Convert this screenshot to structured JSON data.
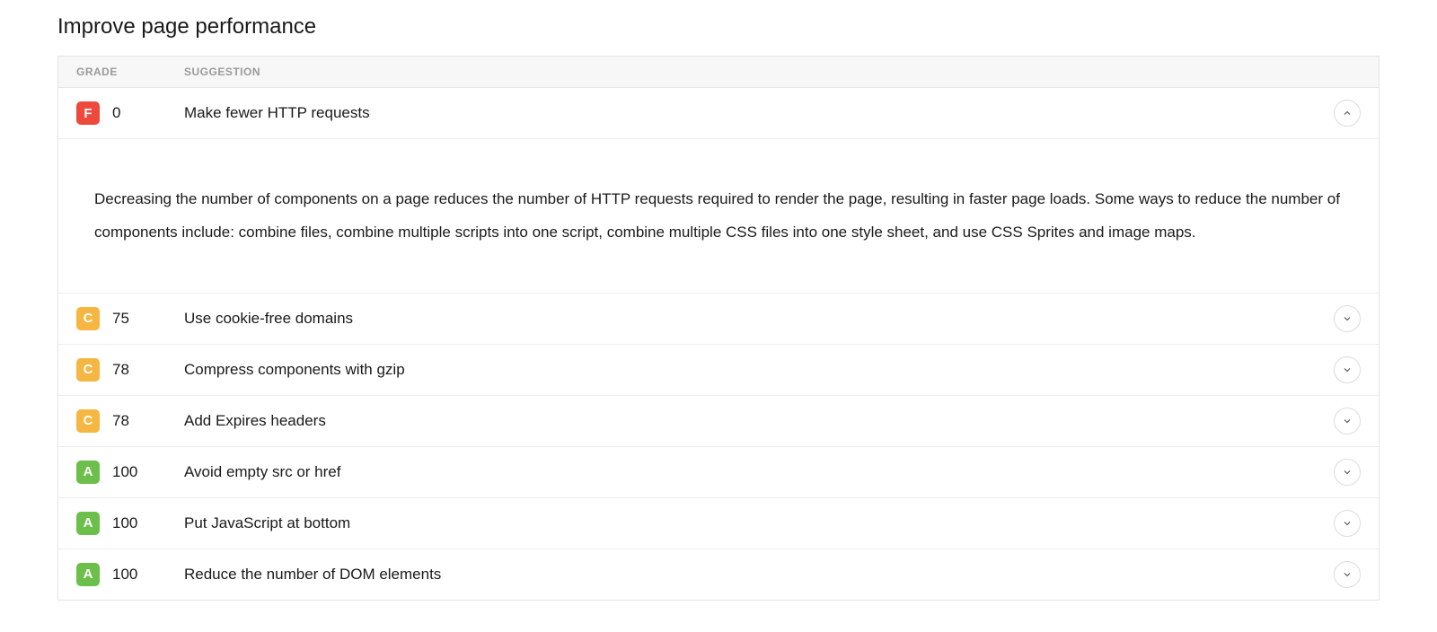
{
  "title": "Improve page performance",
  "columns": {
    "grade": "GRADE",
    "suggestion": "SUGGESTION"
  },
  "gradeColors": {
    "F": "#ed4a3d",
    "C": "#f5b642",
    "A": "#6bbf4a"
  },
  "rows": [
    {
      "grade": "F",
      "score": "0",
      "suggestion": "Make fewer HTTP requests",
      "expanded": true,
      "details": "Decreasing the number of components on a page reduces the number of HTTP requests required to render the page, resulting in faster page loads. Some ways to reduce the number of components include: combine files, combine multiple scripts into one script, combine multiple CSS files into one style sheet, and use CSS Sprites and image maps."
    },
    {
      "grade": "C",
      "score": "75",
      "suggestion": "Use cookie-free domains",
      "expanded": false
    },
    {
      "grade": "C",
      "score": "78",
      "suggestion": "Compress components with gzip",
      "expanded": false
    },
    {
      "grade": "C",
      "score": "78",
      "suggestion": "Add Expires headers",
      "expanded": false
    },
    {
      "grade": "A",
      "score": "100",
      "suggestion": "Avoid empty src or href",
      "expanded": false
    },
    {
      "grade": "A",
      "score": "100",
      "suggestion": "Put JavaScript at bottom",
      "expanded": false
    },
    {
      "grade": "A",
      "score": "100",
      "suggestion": "Reduce the number of DOM elements",
      "expanded": false
    }
  ]
}
